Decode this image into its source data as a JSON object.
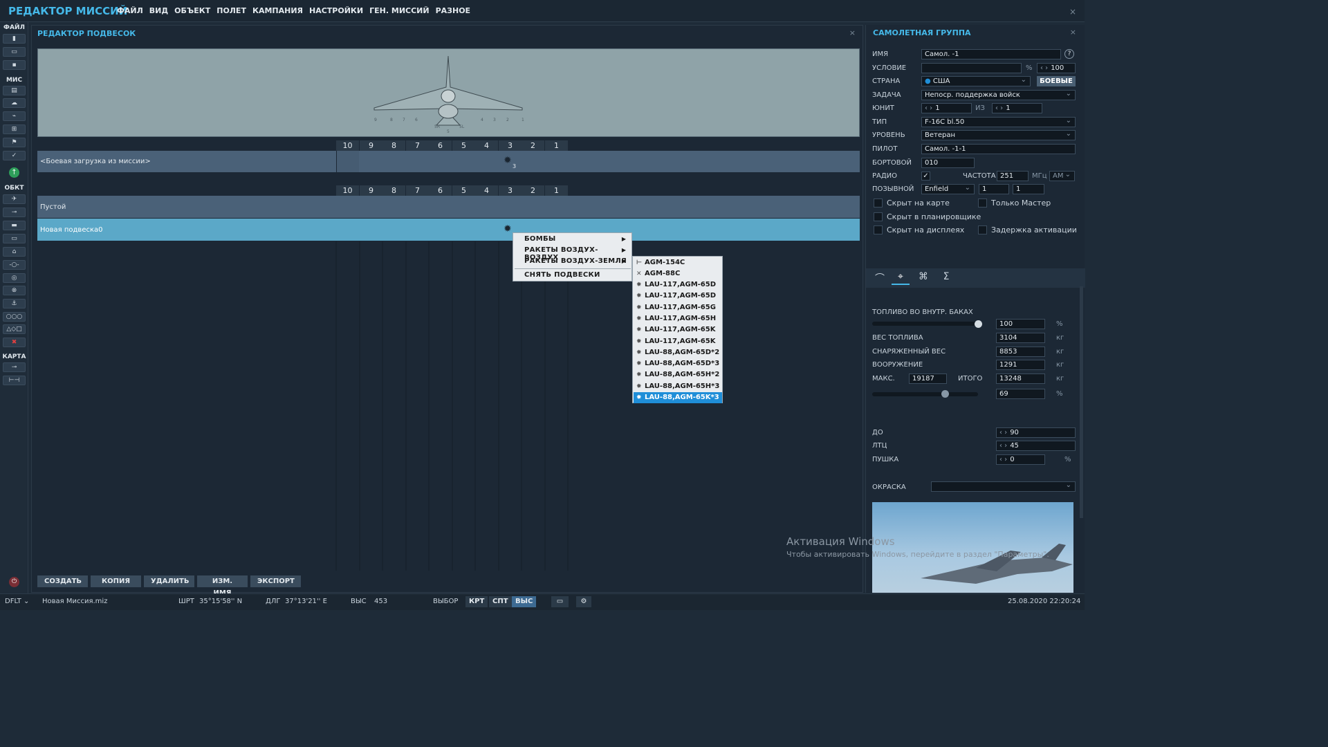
{
  "app": {
    "title": "РЕДАКТОР МИССИЙ",
    "close": "×"
  },
  "menu": [
    "ФАЙЛ",
    "ВИД",
    "ОБЪЕКТ",
    "ПОЛЕТ",
    "КАМПАНИЯ",
    "НАСТРОЙКИ",
    "ГЕН. МИССИЙ",
    "РАЗНОЕ"
  ],
  "toolbar": {
    "file_label": "ФАЙЛ",
    "mis_label": "МИС",
    "obj_label": "ОБКТ",
    "map_label": "КАРТА"
  },
  "loadout": {
    "title": "РЕДАКТОР ПОДВЕСОК",
    "close": "×",
    "pylons": [
      "10",
      "9",
      "8",
      "7",
      "6",
      "5",
      "4",
      "3",
      "2",
      "1"
    ],
    "preview_labels": [
      "9",
      "8",
      "7",
      "6",
      "4",
      "3",
      "2",
      "1",
      "5R",
      "5L",
      "5"
    ],
    "mission_row": "<Боевая загрузка из миссии>",
    "mission_badge": "3",
    "rows": [
      "Пустой",
      "Новая подвеска0"
    ],
    "buttons": [
      "СОЗДАТЬ",
      "КОПИЯ",
      "УДАЛИТЬ",
      "ИЗМ. ИМЯ",
      "ЭКСПОРТ"
    ]
  },
  "context_menu": {
    "items": [
      "БОМБЫ",
      "РАКЕТЫ ВОЗДУХ-ВОЗДУХ",
      "РАКЕТЫ ВОЗДУХ-ЗЕМЛЯ",
      "СНЯТЬ ПОДВЕСКИ"
    ],
    "submenu": [
      "AGM-154C",
      "AGM-88C",
      "LAU-117,AGM-65D",
      "LAU-117,AGM-65D",
      "LAU-117,AGM-65G",
      "LAU-117,AGM-65H",
      "LAU-117,AGM-65K",
      "LAU-117,AGM-65K",
      "LAU-88,AGM-65D*2",
      "LAU-88,AGM-65D*3",
      "LAU-88,AGM-65H*2",
      "LAU-88,AGM-65H*3",
      "LAU-88,AGM-65K*3"
    ],
    "selected_index": 12
  },
  "group": {
    "title": "САМОЛЕТНАЯ ГРУППА",
    "close": "×",
    "labels": {
      "name": "ИМЯ",
      "condition": "УСЛОВИЕ",
      "country": "СТРАНА",
      "task": "ЗАДАЧА",
      "unit": "ЮНИТ",
      "of": "ИЗ",
      "type": "ТИП",
      "level": "УРОВЕНЬ",
      "pilot": "ПИЛОТ",
      "board": "БОРТОВОЙ",
      "radio": "РАДИО",
      "freq": "ЧАСТОТА",
      "callsign": "ПОЗЫВНОЙ"
    },
    "name": "Самол. -1",
    "help": "?",
    "condition_unit": "%",
    "condition": "100",
    "country": "США",
    "combat_btn": "БОЕВЫЕ",
    "task": "Непоср. поддержка войск",
    "unit": "1",
    "unit_of": "1",
    "type": "F-16C bl.50",
    "level": "Ветеран",
    "pilot": "Самол. -1-1",
    "board": "010",
    "radio_check": "✓",
    "freq": "251",
    "freq_unit": "МГц",
    "modulation": "AM",
    "callsign": "Enfield",
    "callsign_n1": "1",
    "callsign_n2": "1",
    "checks": [
      "Скрыт на карте",
      "Только Мастер",
      "Скрыт в планировщике",
      "Скрыт на дисплеях",
      "Задержка активации"
    ],
    "tabs": [
      "route-icon",
      "loadout-icon",
      "triggers-icon",
      "summary-icon"
    ],
    "tab_glyphs": [
      "⌒",
      "⌖",
      "⌘",
      "Σ"
    ]
  },
  "fuel": {
    "labels": {
      "internal": "ТОПЛИВО ВО ВНУТР. БАКАХ",
      "fuel_w": "ВЕС ТОПЛИВА",
      "empty_w": "СНАРЯЖЕННЫЙ ВЕС",
      "weapons": "ВООРУЖЕНИЕ",
      "max": "МАКС.",
      "total": "ИТОГО",
      "chaff": "ДО",
      "flare": "ЛТЦ",
      "gun": "ПУШКА",
      "livery": "ОКРАСКА"
    },
    "internal_pct": "100",
    "internal_fraction": 1.0,
    "fuel_weight": "3104",
    "empty_weight": "8853",
    "weapons_weight": "1291",
    "max_weight": "19187",
    "total_weight": "13248",
    "load_pct": "69",
    "load_fraction": 0.69,
    "chaff": "90",
    "flare": "45",
    "gun": "0",
    "unit_pct": "%",
    "unit_kg": "кг"
  },
  "status": {
    "profile": "DFLT",
    "file": "Новая Миссия.miz",
    "lat_label": "ШРТ",
    "lat": "35°15'58'' N",
    "lon_label": "ДЛГ",
    "lon": "37°13'21'' E",
    "alt_label": "ВЫС",
    "alt": "453",
    "mode_label": "ВЫБОР",
    "btns": [
      "КРТ",
      "СПТ",
      "ВЫС"
    ],
    "datetime": "25.08.2020 22:20:24"
  },
  "watermark": {
    "line1": "Активация Windows",
    "line2": "Чтобы активировать Windows, перейдите в раздел \"Параметры\"."
  },
  "colors": {
    "accent": "#45b8e8",
    "selected_row": "#5ba8c8",
    "menu_highlight": "#1f8ed8"
  }
}
